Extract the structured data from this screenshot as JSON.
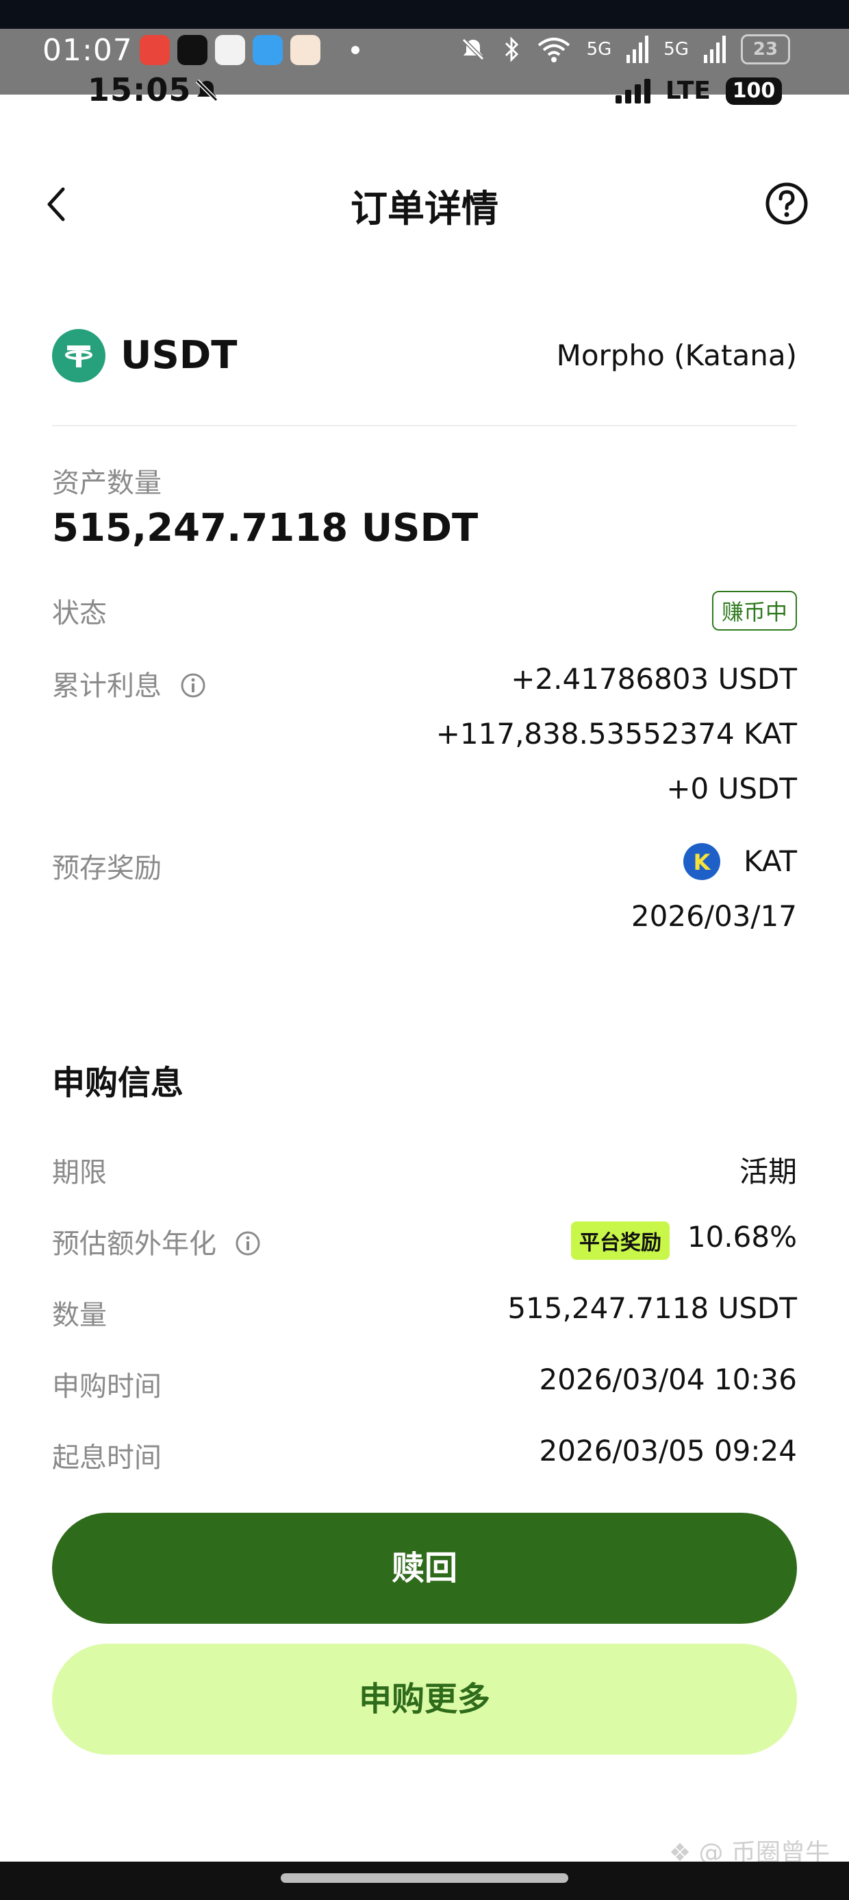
{
  "system_overlay": {
    "time": "01:07",
    "net_labels": [
      "5G",
      "5G"
    ],
    "battery": "23"
  },
  "status_bar": {
    "time": "15:05",
    "network": "LTE",
    "battery": "100"
  },
  "header": {
    "title": "订单详情"
  },
  "asset": {
    "symbol": "USDT",
    "protocol": "Morpho (Katana)"
  },
  "details": {
    "amount_label": "资产数量",
    "amount_value": "515,247.7118 USDT",
    "status_label": "状态",
    "status_value": "赚币中",
    "interest_label": "累计利息",
    "interest_lines": [
      "+2.41786803 USDT",
      "+117,838.53552374 KAT",
      "+0 USDT"
    ],
    "reward_label": "预存奖励",
    "reward_token": "KAT",
    "reward_token_letter": "K",
    "reward_date": "2026/03/17"
  },
  "subscription": {
    "title": "申购信息",
    "term_label": "期限",
    "term_value": "活期",
    "apr_label": "预估额外年化",
    "apr_badge": "平台奖励",
    "apr_value": "10.68%",
    "quantity_label": "数量",
    "quantity_value": "515,247.7118 USDT",
    "subscribe_time_label": "申购时间",
    "subscribe_time_value": "2026/03/04 10:36",
    "start_time_label": "起息时间",
    "start_time_value": "2026/03/05 09:24"
  },
  "actions": {
    "redeem_label": "赎回",
    "subscribe_more_label": "申购更多"
  },
  "watermark": "币圈曾牛",
  "colors": {
    "primary_green": "#2e6b1a",
    "light_green": "#dcfba7",
    "badge_lime": "#c8f74a",
    "tether": "#26a17b"
  }
}
